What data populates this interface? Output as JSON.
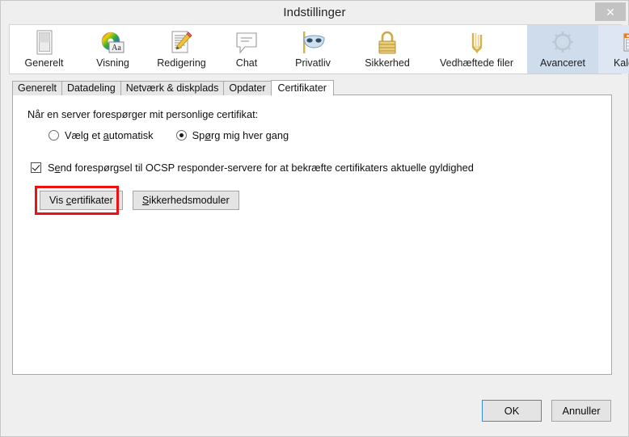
{
  "window": {
    "title": "Indstillinger",
    "close_label": "✕"
  },
  "toolbar": {
    "items": [
      {
        "label": "Generelt",
        "icon": "document-blank-icon",
        "state": "normal"
      },
      {
        "label": "Visning",
        "icon": "color-wheel-aa-icon",
        "state": "normal"
      },
      {
        "label": "Redigering",
        "icon": "pencil-document-icon",
        "state": "normal"
      },
      {
        "label": "Chat",
        "icon": "speech-bubble-icon",
        "state": "normal"
      },
      {
        "label": "Privatliv",
        "icon": "mask-icon",
        "state": "normal"
      },
      {
        "label": "Sikkerhed",
        "icon": "padlock-icon",
        "state": "normal"
      },
      {
        "label": "Vedhæftede filer",
        "icon": "paperclip-icon",
        "state": "normal"
      },
      {
        "label": "Avanceret",
        "icon": "gear-icon",
        "state": "selected"
      },
      {
        "label": "Kalender",
        "icon": "calendar-icon",
        "state": "hover"
      }
    ]
  },
  "tabs": [
    {
      "label": "Generelt",
      "active": false
    },
    {
      "label": "Datadeling",
      "active": false
    },
    {
      "label": "Netværk & diskplads",
      "active": false
    },
    {
      "label": "Opdater",
      "active": false
    },
    {
      "label": "Certifikater",
      "active": true
    }
  ],
  "panel": {
    "heading": "Når en server forespørger mit personlige certifikat:",
    "radios": [
      {
        "pre": "Vælg et ",
        "accel": "a",
        "post": "utomatisk",
        "checked": false
      },
      {
        "pre": "Sp",
        "accel": "ø",
        "post": "rg mig hver gang",
        "checked": true
      }
    ],
    "checkbox": {
      "pre": "S",
      "accel": "e",
      "post": "nd forespørgsel til OCSP responder-servere for at bekræfte certifikaters aktuelle gyldighed",
      "checked": true
    },
    "buttons": [
      {
        "pre": "Vis ",
        "accel": "c",
        "post": "ertifikater",
        "highlighted": true
      },
      {
        "pre": "",
        "accel": "S",
        "post": "ikkerhedsmoduler",
        "highlighted": false
      }
    ]
  },
  "footer": {
    "ok_label": "OK",
    "cancel_label": "Annuller"
  },
  "colors": {
    "selected_tab_bg": "#cfdcec",
    "hover_tab_bg": "#dde6f2",
    "highlight_border": "#ee1111",
    "focus_border": "#3a8ad6",
    "window_bg": "#efefef",
    "panel_bg": "#ffffff"
  }
}
